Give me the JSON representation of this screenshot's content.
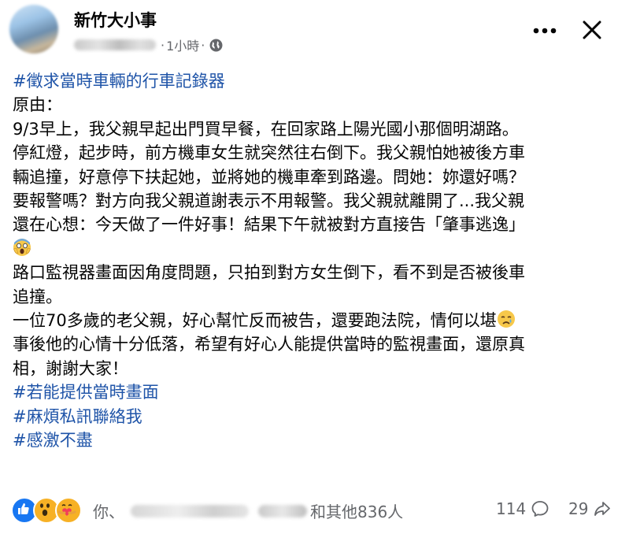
{
  "post": {
    "page_name": "新竹大小事",
    "time": "1小時",
    "separator": "·",
    "lines": [
      {
        "text": "#徵求當時車輛的行車記錄器",
        "hashtag": true
      },
      {
        "text": "原由：",
        "hashtag": false
      },
      {
        "text": "9/3早上，我父親早起出門買早餐，在回家路上陽光國小那個明湖路。",
        "hashtag": false
      },
      {
        "text": "停紅燈，起步時，前方機車女生就突然往右倒下。我父親怕她被後方車",
        "hashtag": false
      },
      {
        "text": "輛追撞，好意停下扶起她，並將她的機車牽到路邊。問她：妳還好嗎？",
        "hashtag": false
      },
      {
        "text": "要報警嗎？對方向我父親道謝表示不用報警。我父親就離開了...我父親",
        "hashtag": false
      },
      {
        "text": "還在心想：今天做了一件好事！結果下午就被對方直接告「肇事逃逸」",
        "hashtag": false
      },
      {
        "text": "",
        "hashtag": false,
        "emoji": "screaming-face-emoji"
      },
      {
        "text": "路口監視器畫面因角度問題，只拍到對方女生倒下，看不到是否被後車",
        "hashtag": false
      },
      {
        "text": "追撞。",
        "hashtag": false
      },
      {
        "text": "一位70多歲的老父親，好心幫忙反而被告，還要跑法院，情何以堪",
        "hashtag": false,
        "emoji": "sad-face-emoji"
      },
      {
        "text": "事後他的心情十分低落，希望有好心人能提供當時的監視畫面，還原真",
        "hashtag": false
      },
      {
        "text": "相，謝謝大家！",
        "hashtag": false
      },
      {
        "text": "#若能提供當時畫面",
        "hashtag": true
      },
      {
        "text": "#麻煩私訊聯絡我",
        "hashtag": true
      },
      {
        "text": "#感激不盡",
        "hashtag": true
      }
    ]
  },
  "footer": {
    "reactions": [
      "like-icon",
      "wow-icon",
      "care-icon"
    ],
    "you_label": "你、",
    "and_others": "和其他836人",
    "comment_count": "114",
    "share_count": "29"
  },
  "colors": {
    "hashtag": "#1f54a8",
    "secondary_text": "#65676b",
    "like_blue": "#1877f2",
    "emoji_yellow": "#f7b125"
  }
}
